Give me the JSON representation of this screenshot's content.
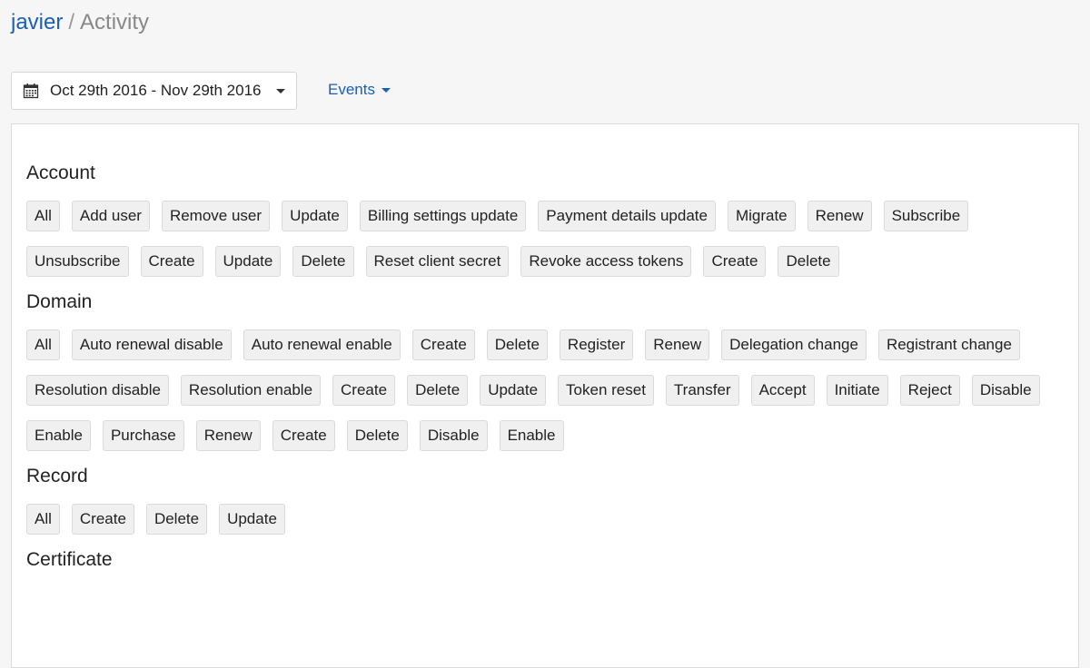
{
  "breadcrumb": {
    "user": "javier",
    "separator": "/",
    "current": "Activity"
  },
  "date_range": {
    "label": "Oct 29th 2016 - Nov 29th 2016"
  },
  "events_menu": {
    "label": "Events"
  },
  "groups": [
    {
      "title": "Account",
      "tags": [
        "All",
        "Add user",
        "Remove user",
        "Update",
        "Billing settings update",
        "Payment details update",
        "Migrate",
        "Renew",
        "Subscribe",
        "Unsubscribe",
        "Create",
        "Update",
        "Delete",
        "Reset client secret",
        "Revoke access tokens",
        "Create",
        "Delete"
      ]
    },
    {
      "title": "Domain",
      "tags": [
        "All",
        "Auto renewal disable",
        "Auto renewal enable",
        "Create",
        "Delete",
        "Register",
        "Renew",
        "Delegation change",
        "Registrant change",
        "Resolution disable",
        "Resolution enable",
        "Create",
        "Delete",
        "Update",
        "Token reset",
        "Transfer",
        "Accept",
        "Initiate",
        "Reject",
        "Disable",
        "Enable",
        "Purchase",
        "Renew",
        "Create",
        "Delete",
        "Disable",
        "Enable"
      ]
    },
    {
      "title": "Record",
      "tags": [
        "All",
        "Create",
        "Delete",
        "Update"
      ]
    },
    {
      "title": "Certificate",
      "tags": []
    }
  ],
  "colors": {
    "link": "#1a5fb4",
    "tag_bg": "#f0f0f0",
    "tag_border": "#dadada"
  }
}
